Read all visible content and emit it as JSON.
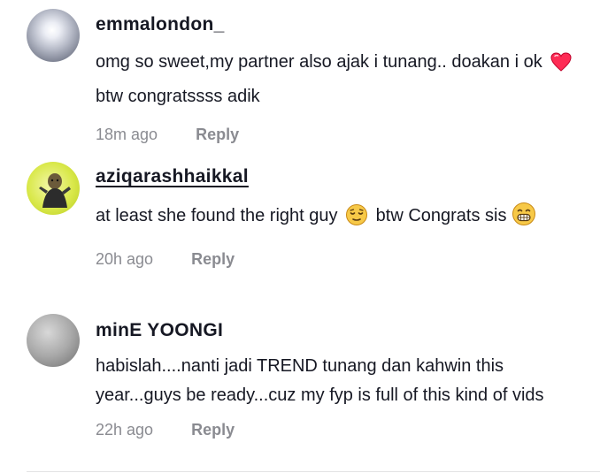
{
  "comments": [
    {
      "username": "emmalondon_",
      "text_before": "omg so sweet,my partner also ajak i tunang.. doakan i ok",
      "emoji1": "heart-emoji",
      "text_after": "btw congratssss adik",
      "time": "18m ago",
      "reply_label": "Reply"
    },
    {
      "username": "aziqarashhaikkal",
      "text_before": "at least she found the right guy",
      "emoji1": "relieved-face-emoji",
      "text_after": "btw Congrats sis",
      "emoji2": "grinning-face-emoji",
      "time": "20h ago",
      "reply_label": "Reply"
    },
    {
      "username": "minE YOONGI",
      "text": "habislah....nanti jadi TREND tunang dan kahwin this year...guys be ready...cuz my fyp is full of this kind of vids",
      "time": "22h ago",
      "reply_label": "Reply"
    }
  ],
  "colors": {
    "text": "#161823",
    "meta": "#8a8b91",
    "heart": "#fe2c55",
    "emoji_yellow": "#f7c948"
  }
}
